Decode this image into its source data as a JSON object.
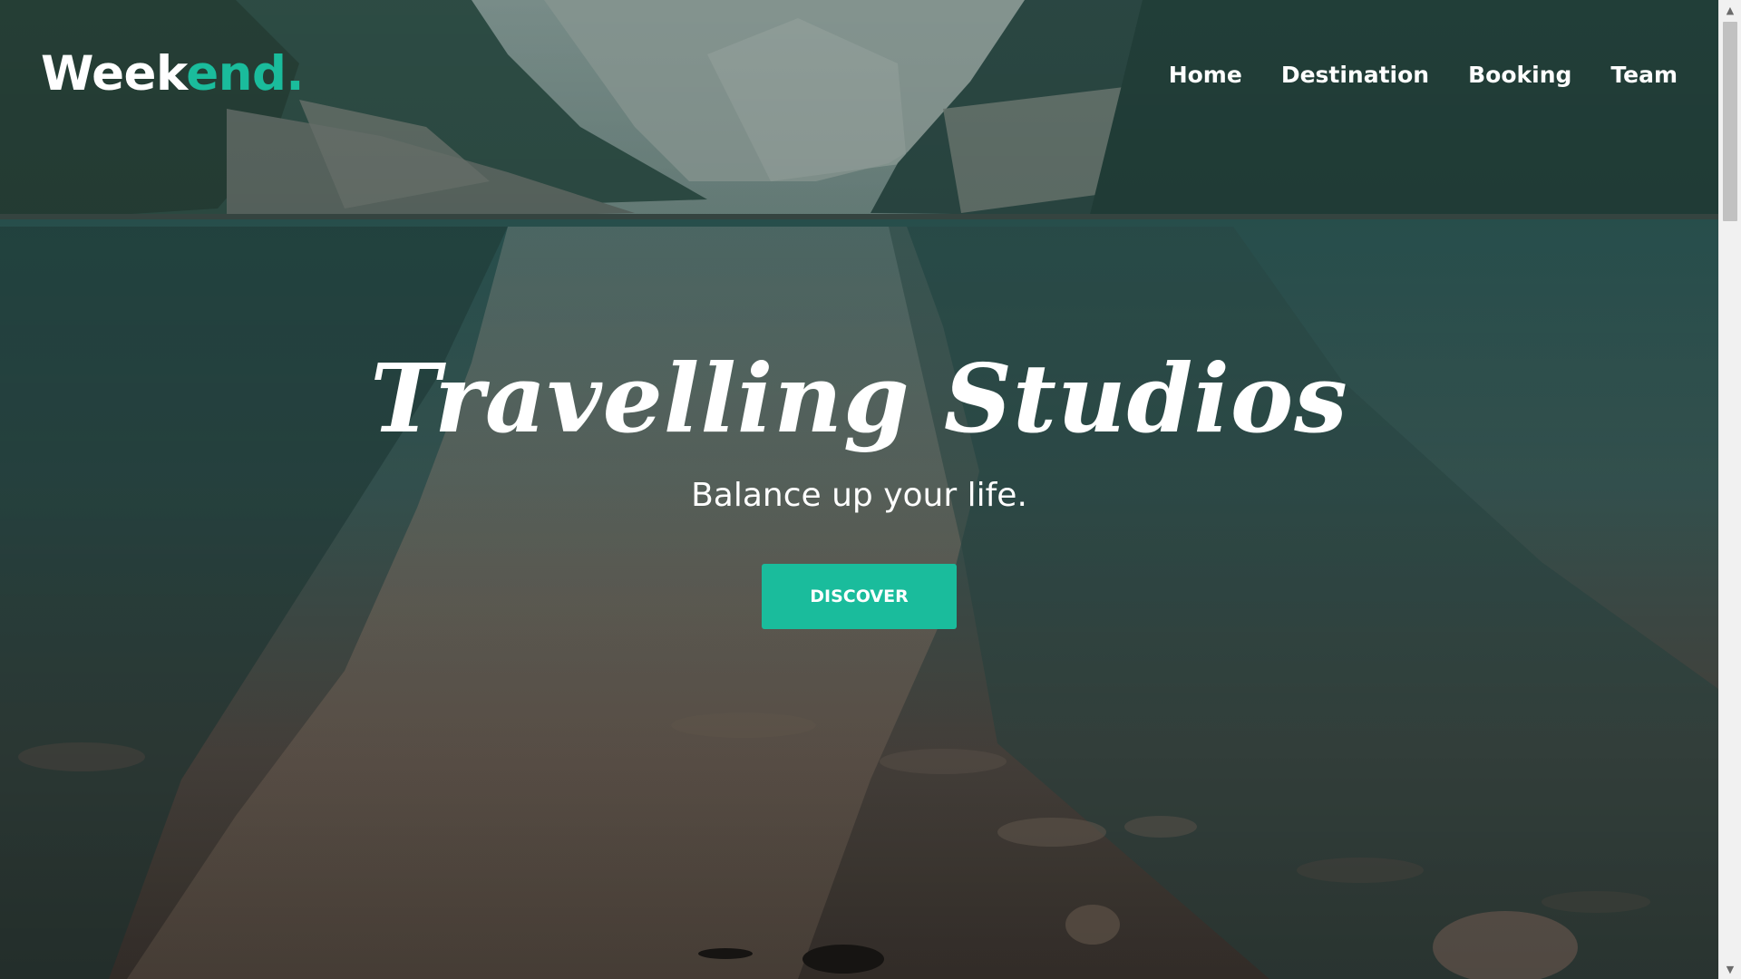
{
  "brand": {
    "logo_part1": "Week",
    "logo_part2": "end.",
    "accent_color": "#1abc9c"
  },
  "nav": {
    "items": [
      {
        "label": "Home"
      },
      {
        "label": "Destination"
      },
      {
        "label": "Booking"
      },
      {
        "label": "Team"
      }
    ]
  },
  "hero": {
    "title": "Travelling Studios",
    "subtitle": "Balance up your life.",
    "cta_label": "DISCOVER",
    "background": "mountain-lake-landscape"
  },
  "scrollbar": {
    "up_icon": "chevron-up-icon",
    "down_icon": "chevron-down-icon"
  }
}
